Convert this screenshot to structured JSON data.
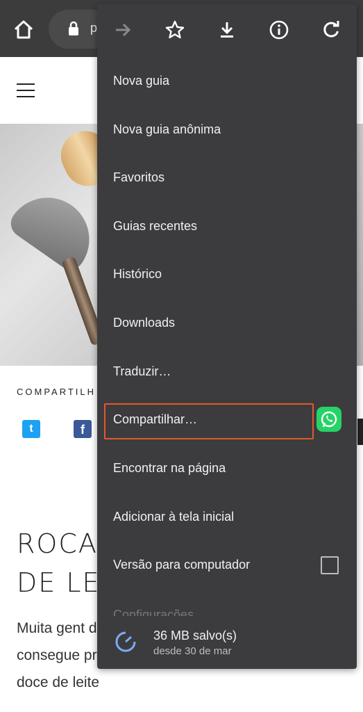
{
  "browser": {
    "url_partial": "p",
    "menu_toolbar": {
      "forward": "forward-arrow-icon",
      "bookmark": "star-icon",
      "download": "download-icon",
      "info": "info-icon",
      "refresh": "refresh-icon"
    }
  },
  "menu": {
    "items": [
      "Nova guia",
      "Nova guia anônima",
      "Favoritos",
      "Guias recentes",
      "Histórico",
      "Downloads",
      "Traduzir…",
      "Compartilhar…",
      "Encontrar na página",
      "Adicionar à tela inicial",
      "Versão para computador"
    ],
    "settings_faded": "Configurações",
    "footer": {
      "main": "36 MB salvo(s)",
      "sub": "desde 30 de mar"
    },
    "highlight_color": "#e25a2a"
  },
  "page": {
    "share_label": "COMPARTILH",
    "title_line1": "ROCA",
    "title_line2": "DE LE",
    "body": "Muita gent difícil. Mas ver que até criança consegue preparar. E o recheio é pura nostalgia: doce de leite"
  }
}
